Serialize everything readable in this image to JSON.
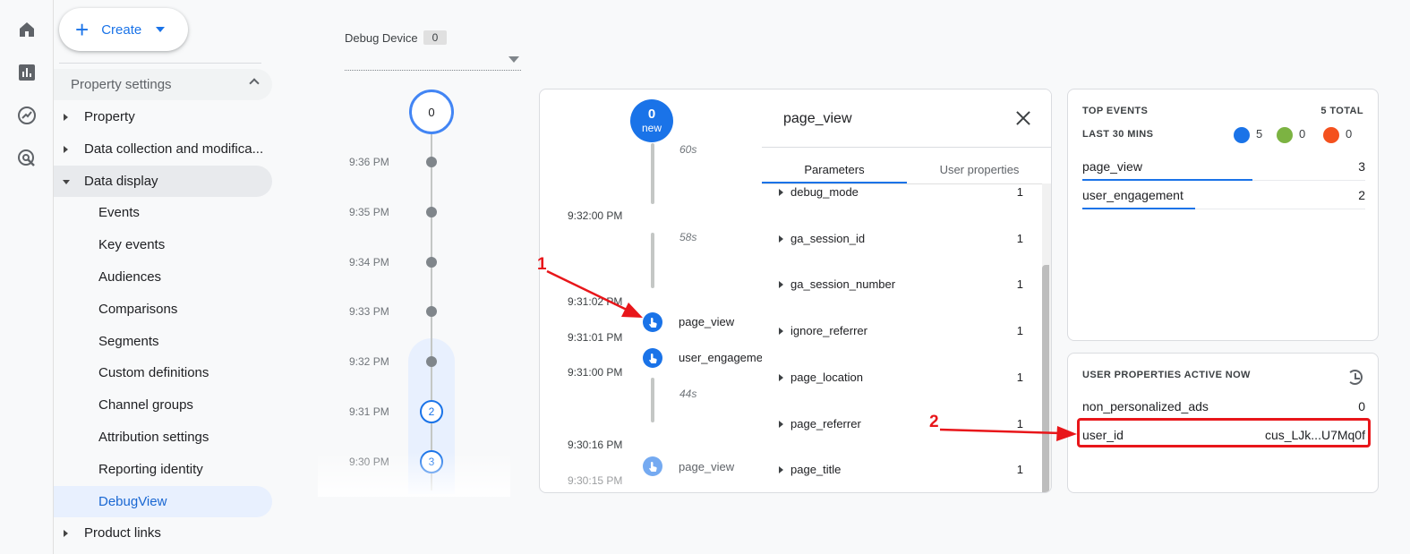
{
  "rail": {
    "icons": [
      "home-icon",
      "reports-icon",
      "explore-icon",
      "advertising-icon"
    ]
  },
  "nav": {
    "create_label": "Create",
    "section_title": "Property settings",
    "items": [
      {
        "label": "Property",
        "type": "collapsed"
      },
      {
        "label": "Data collection and modifica...",
        "type": "collapsed"
      },
      {
        "label": "Data display",
        "type": "expanded"
      },
      {
        "label": "Events",
        "type": "sub"
      },
      {
        "label": "Key events",
        "type": "sub"
      },
      {
        "label": "Audiences",
        "type": "sub"
      },
      {
        "label": "Comparisons",
        "type": "sub"
      },
      {
        "label": "Segments",
        "type": "sub"
      },
      {
        "label": "Custom definitions",
        "type": "sub"
      },
      {
        "label": "Channel groups",
        "type": "sub"
      },
      {
        "label": "Attribution settings",
        "type": "sub"
      },
      {
        "label": "Reporting identity",
        "type": "sub"
      },
      {
        "label": "DebugView",
        "type": "active"
      },
      {
        "label": "Product links",
        "type": "collapsed"
      }
    ]
  },
  "device": {
    "label": "Debug Device",
    "count": "0"
  },
  "minutes": {
    "top_count": "0",
    "rows": [
      {
        "time": "9:36 PM",
        "count": ""
      },
      {
        "time": "9:35 PM",
        "count": ""
      },
      {
        "time": "9:34 PM",
        "count": ""
      },
      {
        "time": "9:33 PM",
        "count": ""
      },
      {
        "time": "9:32 PM",
        "count": ""
      },
      {
        "time": "9:31 PM",
        "count": "2"
      },
      {
        "time": "9:30 PM",
        "count": "3"
      }
    ]
  },
  "seconds": {
    "bubble_count": "0",
    "bubble_label": "new",
    "gaps": [
      "60s",
      "58s",
      "44s"
    ],
    "times": [
      "9:32:00 PM",
      "9:31:02 PM",
      "9:31:01 PM",
      "9:31:00 PM",
      "9:30:16 PM",
      "9:30:15 PM"
    ],
    "events": [
      "page_view",
      "user_engagement",
      "page_view"
    ]
  },
  "detail": {
    "title": "page_view",
    "tabs": [
      "Parameters",
      "User properties"
    ],
    "params": [
      {
        "name": "debug_mode",
        "value": "1"
      },
      {
        "name": "ga_session_id",
        "value": "1"
      },
      {
        "name": "ga_session_number",
        "value": "1"
      },
      {
        "name": "ignore_referrer",
        "value": "1"
      },
      {
        "name": "page_location",
        "value": "1"
      },
      {
        "name": "page_referrer",
        "value": "1"
      },
      {
        "name": "page_title",
        "value": "1"
      }
    ]
  },
  "top_events": {
    "title": "TOP EVENTS",
    "total": "5 TOTAL",
    "period": "LAST 30 MINS",
    "counts": {
      "events": "5",
      "conversions": "0",
      "errors": "0"
    },
    "rows": [
      {
        "name": "page_view",
        "value": "3",
        "share": 0.6
      },
      {
        "name": "user_engagement",
        "value": "2",
        "share": 0.4
      }
    ]
  },
  "user_props": {
    "title": "USER PROPERTIES ACTIVE NOW",
    "rows": [
      {
        "name": "non_personalized_ads",
        "value": "0"
      },
      {
        "name": "user_id",
        "value": "cus_LJk...U7Mq0f"
      }
    ]
  },
  "annotations": [
    "1",
    "2"
  ],
  "colors": {
    "accent": "#1a73e8",
    "annotation": "#e8161a",
    "key_event": "#7cb342",
    "error": "#f4511e"
  }
}
